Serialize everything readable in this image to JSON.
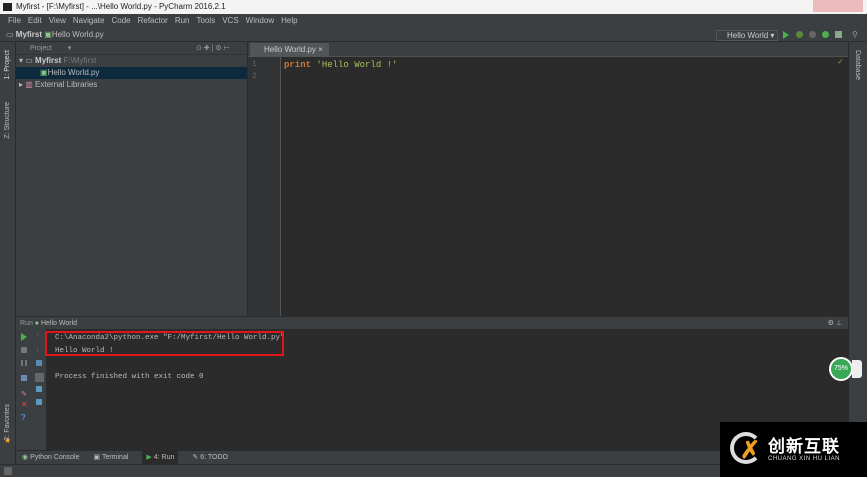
{
  "window": {
    "title": "Myfirst - [F:\\Myfirst] - ...\\Hello World.py - PyCharm 2016.2.1"
  },
  "menu": [
    "File",
    "Edit",
    "View",
    "Navigate",
    "Code",
    "Refactor",
    "Run",
    "Tools",
    "VCS",
    "Window",
    "Help"
  ],
  "nav": {
    "project": "Myfirst",
    "file": "Hello World.py"
  },
  "toolbar": {
    "run_config": "Hello World"
  },
  "sidebar_tabs": {
    "project": "1: Project",
    "structure": "Z: Structure",
    "favorites": "2: Favorites",
    "database": "Database"
  },
  "project_panel": {
    "header": "Project",
    "root": "Myfirst",
    "root_path": "F:\\Myfirst",
    "file": "Hello World.py",
    "libs": "External Libraries"
  },
  "editor": {
    "tab": "Hello World.py",
    "line_numbers": [
      "1",
      "2"
    ],
    "code_kw": "print",
    "code_str": "'Hello World !'"
  },
  "run": {
    "label": "Run",
    "config": "Hello World",
    "lines": [
      "C:\\Anaconda2\\python.exe \"F:/Myfirst/Hello World.py\"",
      "Hello World !",
      "",
      "Process finished with exit code 0"
    ]
  },
  "bottom_tabs": [
    "Python Console",
    "Terminal",
    "4: Run",
    "6: TODO"
  ],
  "gauge": {
    "value": "75%"
  },
  "watermark": {
    "title": "创新互联",
    "subtitle": "CHUANG XIN HU LIAN"
  }
}
